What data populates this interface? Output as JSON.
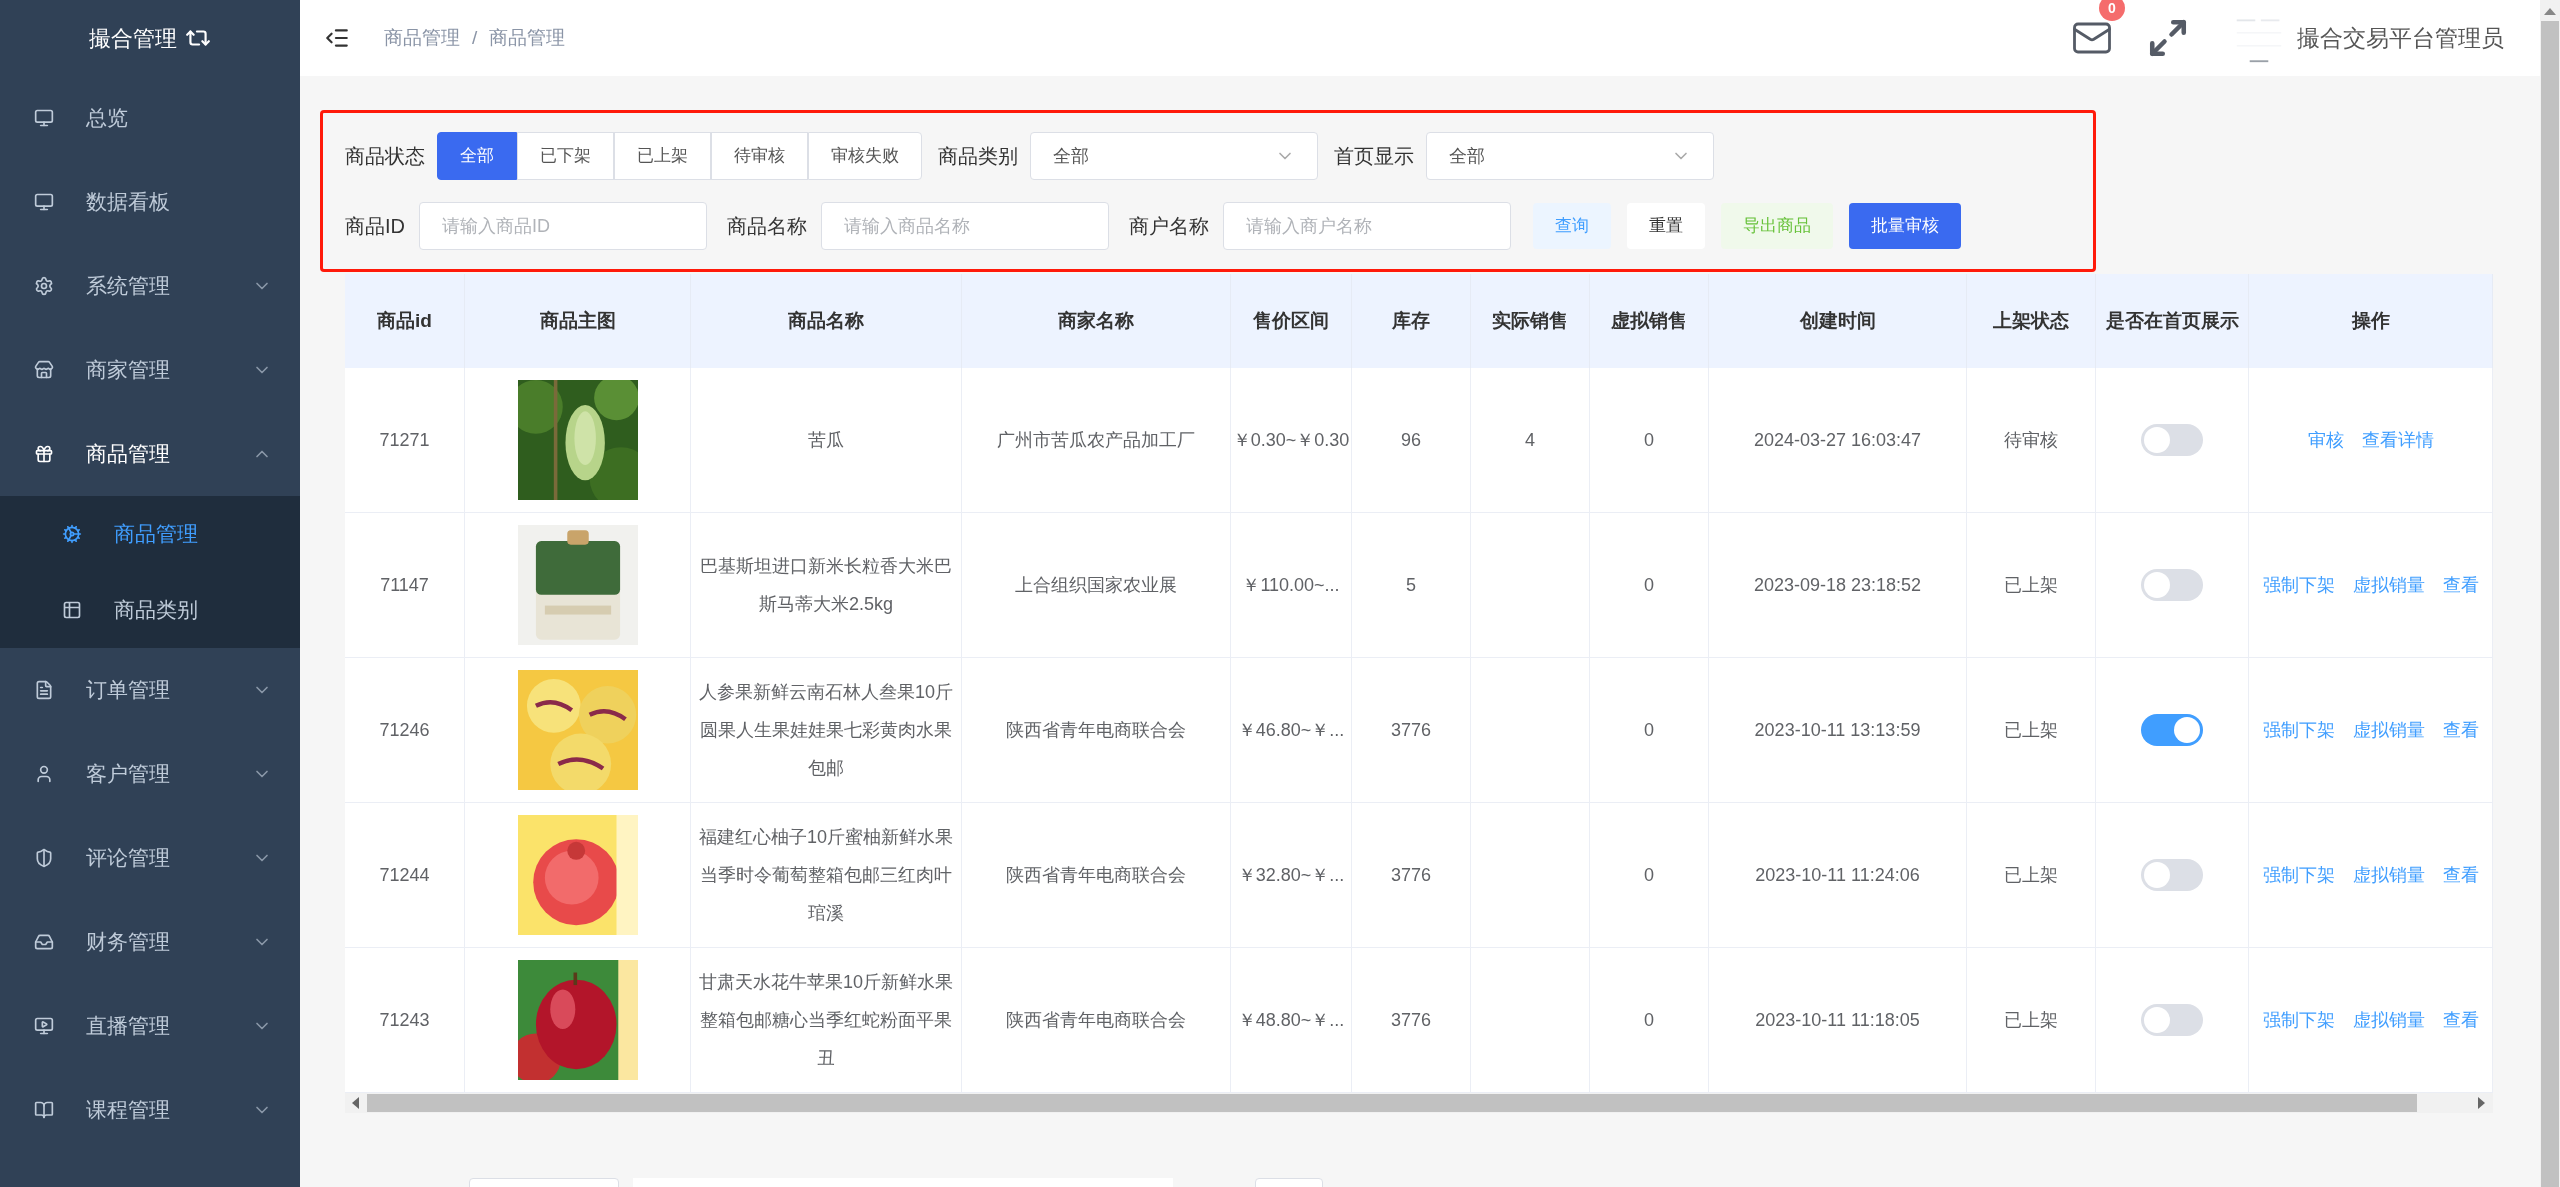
{
  "sidebar": {
    "title": "撮合管理",
    "items": [
      {
        "label": "总览",
        "expandable": false,
        "expanded": false
      },
      {
        "label": "数据看板",
        "expandable": false,
        "expanded": false
      },
      {
        "label": "系统管理",
        "expandable": true,
        "expanded": false
      },
      {
        "label": "商家管理",
        "expandable": true,
        "expanded": false
      },
      {
        "label": "商品管理",
        "expandable": true,
        "expanded": true,
        "children": [
          {
            "label": "商品管理",
            "selected": true
          },
          {
            "label": "商品类别",
            "selected": false
          }
        ]
      },
      {
        "label": "订单管理",
        "expandable": true,
        "expanded": false
      },
      {
        "label": "客户管理",
        "expandable": true,
        "expanded": false
      },
      {
        "label": "评论管理",
        "expandable": true,
        "expanded": false
      },
      {
        "label": "财务管理",
        "expandable": true,
        "expanded": false
      },
      {
        "label": "直播管理",
        "expandable": true,
        "expanded": false
      },
      {
        "label": "课程管理",
        "expandable": true,
        "expanded": false
      }
    ]
  },
  "header": {
    "breadcrumb": [
      "商品管理",
      "商品管理"
    ],
    "separator": "/",
    "mail_badge": "0",
    "user": "撮合交易平台管理员"
  },
  "filters": {
    "status": {
      "label": "商品状态",
      "tabs": [
        {
          "label": "全部",
          "selected": true
        },
        {
          "label": "已下架",
          "selected": false
        },
        {
          "label": "已上架",
          "selected": false
        },
        {
          "label": "待审核",
          "selected": false
        },
        {
          "label": "审核失败",
          "selected": false
        }
      ]
    },
    "selects": [
      {
        "label": "商品类别",
        "value": "全部"
      },
      {
        "label": "首页显示",
        "value": "全部"
      }
    ],
    "inputs": [
      {
        "label": "商品ID",
        "placeholder": "请输入商品ID"
      },
      {
        "label": "商品名称",
        "placeholder": "请输入商品名称"
      },
      {
        "label": "商户名称",
        "placeholder": "请输入商户名称"
      }
    ],
    "buttons": [
      {
        "label": "查询",
        "kind": "query"
      },
      {
        "label": "重置",
        "kind": "reset"
      },
      {
        "label": "导出商品",
        "kind": "export"
      },
      {
        "label": "批量审核",
        "kind": "primary"
      }
    ]
  },
  "table": {
    "columns": [
      "商品id",
      "商品主图",
      "商品名称",
      "商家名称",
      "售价区间",
      "库存",
      "实际销售",
      "虚拟销售",
      "创建时间",
      "上架状态",
      "是否在首页展示",
      "操作"
    ],
    "rows": [
      {
        "id": "71271",
        "name": "苦瓜",
        "merchant": "广州市苦瓜农产品加工厂",
        "price": "￥0.30~￥0.30",
        "stock": "96",
        "actual_sales": "4",
        "virtual_sales": "0",
        "created": "2024-03-27 16:03:47",
        "status": "待审核",
        "on_home": false,
        "actions": [
          "审核",
          "查看详情"
        ]
      },
      {
        "id": "71147",
        "name": "巴基斯坦进口新米长粒香大米巴斯马蒂大米2.5kg",
        "merchant": "上合组织国家农业展",
        "price": "￥110.00~...",
        "stock": "5",
        "virtual_sales": "0",
        "created": "2023-09-18 23:18:52",
        "status": "已上架",
        "on_home": false,
        "actions": [
          "强制下架",
          "虚拟销量",
          "查看"
        ]
      },
      {
        "id": "71246",
        "name": "人参果新鲜云南石林人叁果10斤圆果人生果娃娃果七彩黄肉水果包邮",
        "merchant": "陕西省青年电商联合会",
        "price": "￥46.80~￥...",
        "stock": "3776",
        "virtual_sales": "0",
        "created": "2023-10-11 13:13:59",
        "status": "已上架",
        "on_home": true,
        "actions": [
          "强制下架",
          "虚拟销量",
          "查看"
        ]
      },
      {
        "id": "71244",
        "name": "福建红心柚子10斤蜜柚新鲜水果当季时令葡萄整箱包邮三红肉叶琯溪",
        "merchant": "陕西省青年电商联合会",
        "price": "￥32.80~￥...",
        "stock": "3776",
        "virtual_sales": "0",
        "created": "2023-10-11 11:24:06",
        "status": "已上架",
        "on_home": false,
        "actions": [
          "强制下架",
          "虚拟销量",
          "查看"
        ]
      },
      {
        "id": "71243",
        "name": "甘肃天水花牛苹果10斤新鲜水果整箱包邮糖心当季红蛇粉面平果丑",
        "merchant": "陕西省青年电商联合会",
        "price": "￥48.80~￥...",
        "stock": "3776",
        "virtual_sales": "0",
        "created": "2023-10-11 11:18:05",
        "status": "已上架",
        "on_home": false,
        "actions": [
          "强制下架",
          "虚拟销量",
          "查看"
        ]
      }
    ]
  }
}
